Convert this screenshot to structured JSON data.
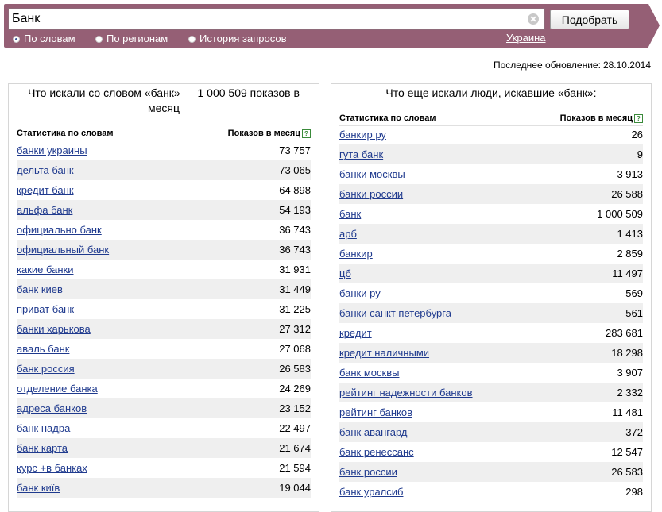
{
  "search": {
    "query": "Банк",
    "submit_label": "Подобрать"
  },
  "modes": [
    {
      "label": "По словам",
      "selected": true
    },
    {
      "label": "По регионам",
      "selected": false
    },
    {
      "label": "История запросов",
      "selected": false
    }
  ],
  "region": "Украина",
  "last_update": {
    "label": "Последнее обновление:",
    "date": "28.10.2014"
  },
  "colors": {
    "header": "#955f75",
    "link": "#1f3a8e",
    "row_alt": "#efefef"
  },
  "left_panel": {
    "title": "Что искали со словом «банк» — 1 000 509 показов в месяц",
    "col_words": "Статистика по словам",
    "col_shows": "Показов в месяц",
    "help_icon": "?",
    "rows": [
      {
        "phrase": "банки украины",
        "count": "73 757"
      },
      {
        "phrase": "дельта банк",
        "count": "73 065"
      },
      {
        "phrase": "кредит банк",
        "count": "64 898"
      },
      {
        "phrase": "альфа банк",
        "count": "54 193"
      },
      {
        "phrase": "официально банк",
        "count": "36 743"
      },
      {
        "phrase": "официальный банк",
        "count": "36 743"
      },
      {
        "phrase": "какие банки",
        "count": "31 931"
      },
      {
        "phrase": "банк киев",
        "count": "31 449"
      },
      {
        "phrase": "приват банк",
        "count": "31 225"
      },
      {
        "phrase": "банки харькова",
        "count": "27 312"
      },
      {
        "phrase": "аваль банк",
        "count": "27 068"
      },
      {
        "phrase": "банк россия",
        "count": "26 583"
      },
      {
        "phrase": "отделение банка",
        "count": "24 269"
      },
      {
        "phrase": "адреса банков",
        "count": "23 152"
      },
      {
        "phrase": "банк надра",
        "count": "22 497"
      },
      {
        "phrase": "банк карта",
        "count": "21 674"
      },
      {
        "phrase": "курс +в банках",
        "count": "21 594"
      },
      {
        "phrase": "банк київ",
        "count": "19 044"
      }
    ]
  },
  "right_panel": {
    "title": "Что еще искали люди, искавшие «банк»:",
    "col_words": "Статистика по словам",
    "col_shows": "Показов в месяц",
    "help_icon": "?",
    "rows": [
      {
        "phrase": "банкир ру",
        "count": "26"
      },
      {
        "phrase": "гута банк",
        "count": "9"
      },
      {
        "phrase": "банки москвы",
        "count": "3 913"
      },
      {
        "phrase": "банки россии",
        "count": "26 588"
      },
      {
        "phrase": "банк",
        "count": "1 000 509"
      },
      {
        "phrase": "арб",
        "count": "1 413"
      },
      {
        "phrase": "банкир",
        "count": "2 859"
      },
      {
        "phrase": "цб",
        "count": "11 497"
      },
      {
        "phrase": "банки ру",
        "count": "569"
      },
      {
        "phrase": "банки санкт петербурга",
        "count": "561"
      },
      {
        "phrase": "кредит",
        "count": "283 681"
      },
      {
        "phrase": "кредит наличными",
        "count": "18 298"
      },
      {
        "phrase": "банк москвы",
        "count": "3 907"
      },
      {
        "phrase": "рейтинг надежности банков",
        "count": "2 332"
      },
      {
        "phrase": "рейтинг банков",
        "count": "11 481"
      },
      {
        "phrase": "банк авангард",
        "count": "372"
      },
      {
        "phrase": "банк ренессанс",
        "count": "12 547"
      },
      {
        "phrase": "банк россии",
        "count": "26 583"
      },
      {
        "phrase": "банк уралсиб",
        "count": "298"
      }
    ]
  }
}
